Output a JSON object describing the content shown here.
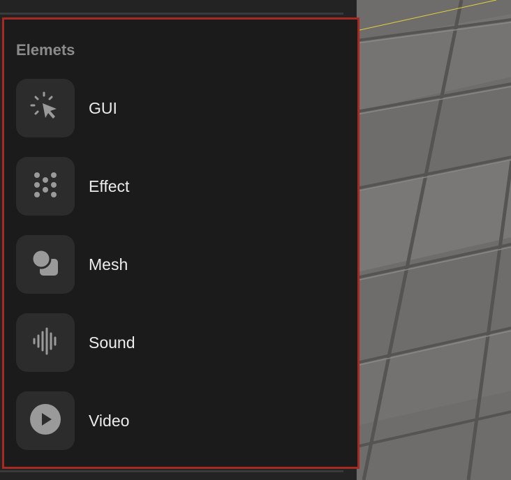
{
  "panel": {
    "title": "Elemets",
    "items": [
      {
        "label": "GUI",
        "icon": "cursor-click-icon"
      },
      {
        "label": "Effect",
        "icon": "particles-icon"
      },
      {
        "label": "Mesh",
        "icon": "shapes-icon"
      },
      {
        "label": "Sound",
        "icon": "sound-wave-icon"
      },
      {
        "label": "Video",
        "icon": "play-circle-icon"
      }
    ]
  },
  "colors": {
    "highlight_border": "#a62a22",
    "tile": "#2c2c2c",
    "icon": "#9a9a9a",
    "viewport": "#6f6d6c"
  }
}
